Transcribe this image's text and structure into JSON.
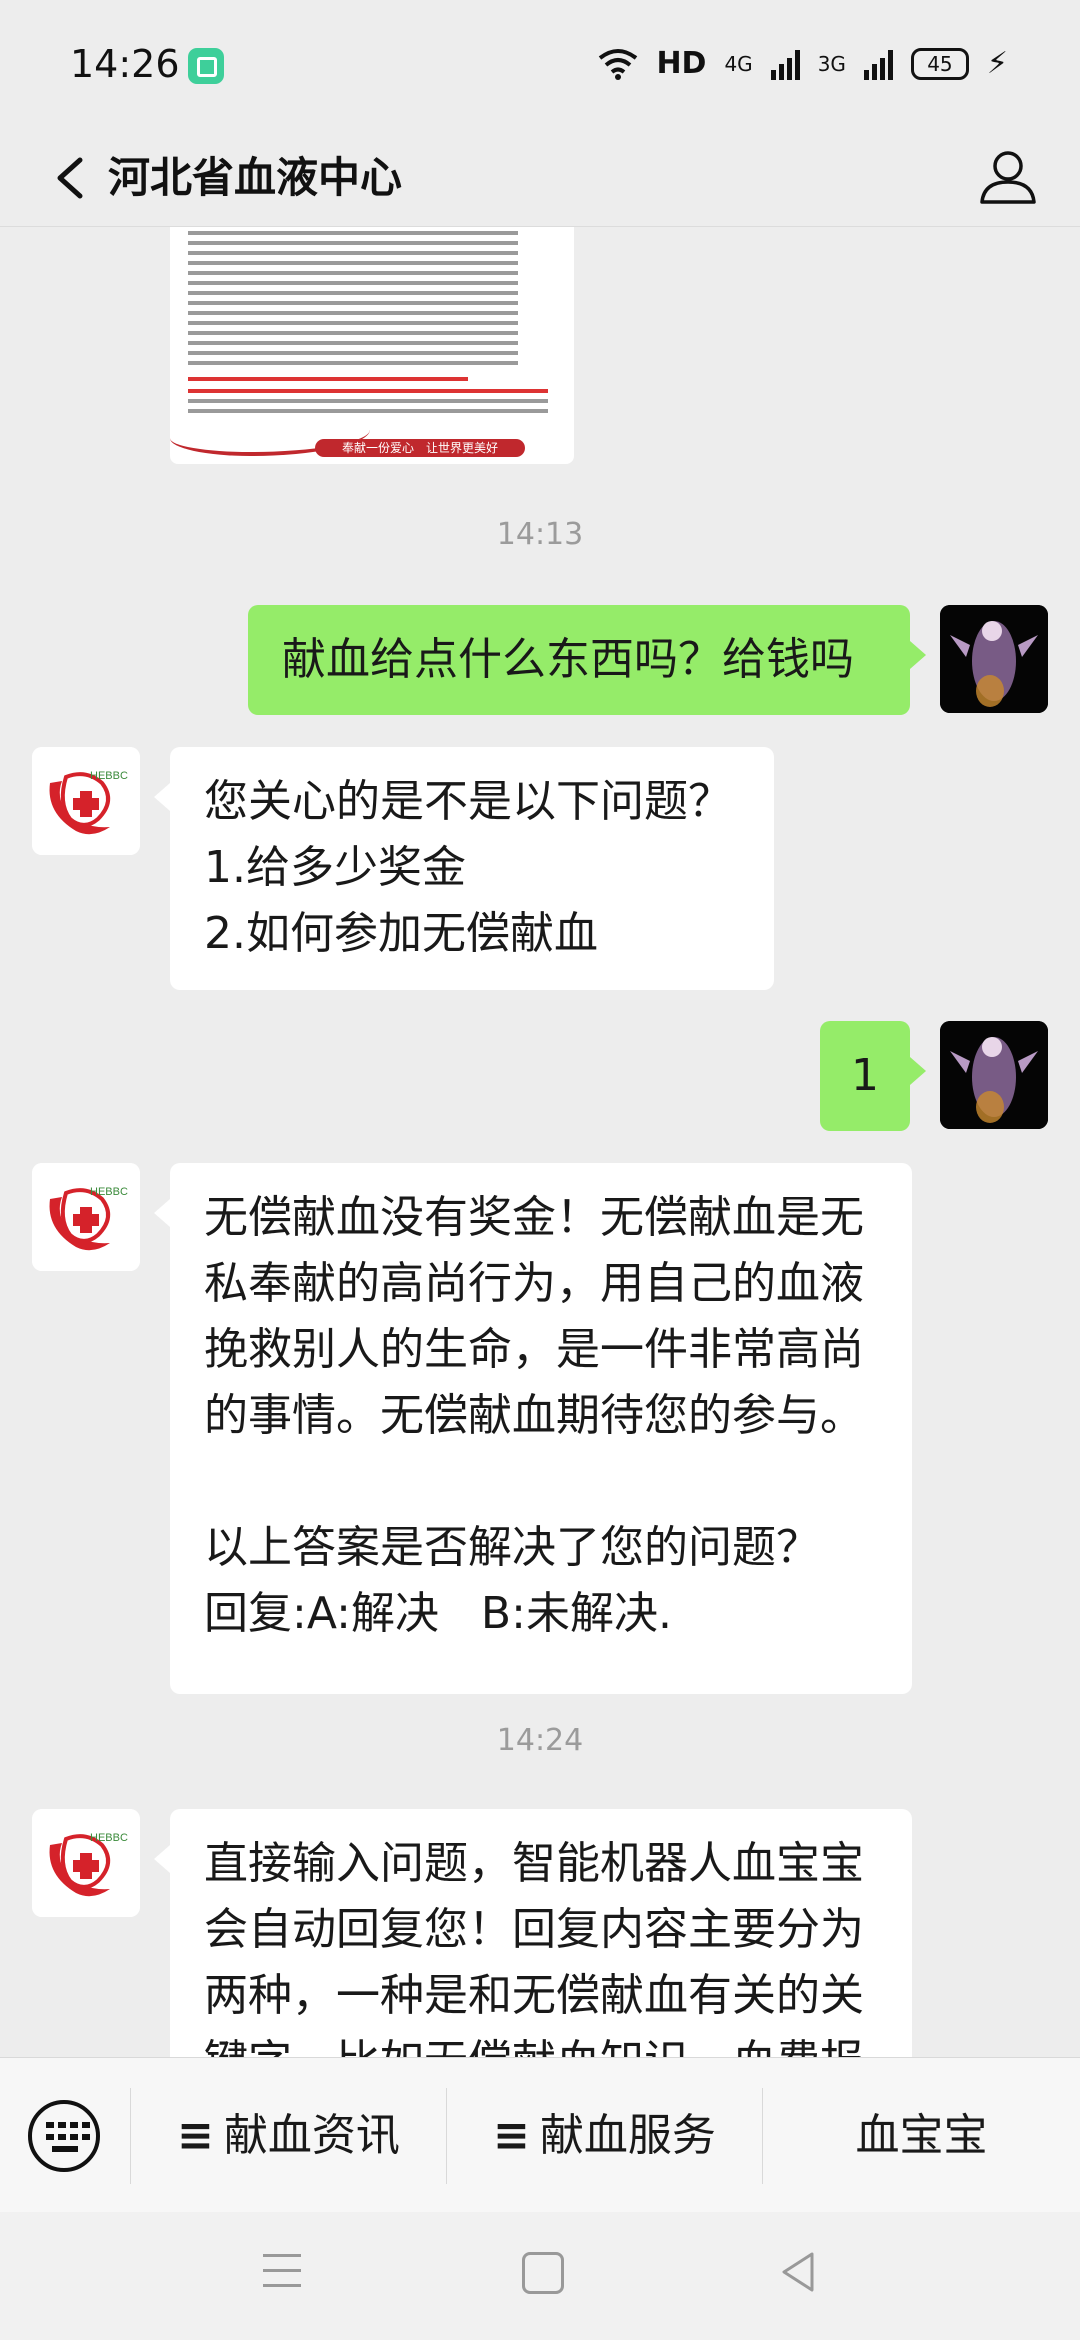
{
  "status_bar": {
    "time": "14:26",
    "network": "HD",
    "signal_1": "4G",
    "signal_2": "3G",
    "battery": "45"
  },
  "header": {
    "title": "河北省血液中心"
  },
  "messages": [
    {
      "timestamp": "14:13"
    },
    {
      "from": "user",
      "lines": [
        "献血给点什么东西吗？给钱吗"
      ]
    },
    {
      "from": "bot",
      "lines": [
        "您关心的是不是以下问题？",
        "1.给多少奖金",
        "2.如何参加无偿献血"
      ]
    },
    {
      "from": "user",
      "lines": [
        "1"
      ]
    },
    {
      "from": "bot",
      "lines": [
        "无偿献血没有奖金！无偿献血是无",
        "私奉献的高尚行为，用自己的血液",
        "挽救别人的生命，是一件非常高尚",
        "的事情。无偿献血期待您的参与。",
        "",
        "以上答案是否解决了您的问题？",
        "回复:A:解决   B:未解决."
      ]
    },
    {
      "timestamp": "14:24"
    },
    {
      "from": "bot",
      "lines": [
        "直接输入问题，智能机器人血宝宝",
        "会自动回复您！回复内容主要分为",
        "两种，一种是和无偿献血有关的关",
        "键字，比如无偿献血知识，血费报"
      ]
    }
  ],
  "bot_avatar_label": "HEBBC",
  "poster": {
    "banner_text": "奉献一份爱心　让世界更美好"
  },
  "menu": {
    "item_1": "献血资讯",
    "item_2": "献血服务",
    "item_3": "血宝宝",
    "prefix": "≡"
  },
  "colors": {
    "outgoing_bubble": "#95ec69",
    "incoming_bubble": "#ffffff",
    "background": "#ededed"
  }
}
